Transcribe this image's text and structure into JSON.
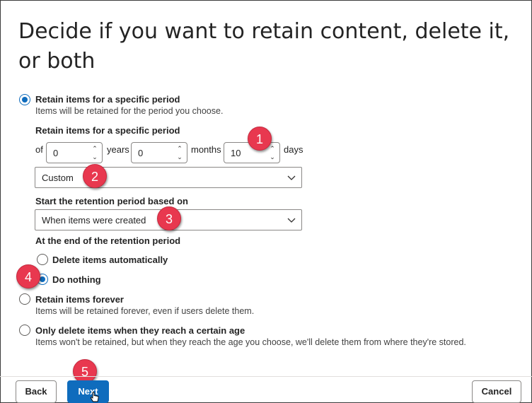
{
  "page": {
    "title": "Decide if you want to retain content, delete it, or both"
  },
  "options": {
    "retain_period": {
      "label": "Retain items for a specific period",
      "description": "Items will be retained for the period you choose.",
      "checked": true
    },
    "retain_forever": {
      "label": "Retain items forever",
      "description": "Items will be retained forever, even if users delete them.",
      "checked": false
    },
    "only_delete": {
      "label": "Only delete items when they reach a certain age",
      "description": "Items won't be retained, but when they reach the age you choose, we'll delete them from where they're stored.",
      "checked": false
    }
  },
  "period": {
    "heading": "Retain items for a specific period",
    "of_label": "of",
    "years_value": "0",
    "years_label": "years",
    "months_value": "0",
    "months_label": "months",
    "days_value": "10",
    "days_label": "days",
    "preset_value": "Custom"
  },
  "retention_start": {
    "heading": "Start the retention period based on",
    "value": "When items were created"
  },
  "end_of_period": {
    "heading": "At the end of the retention period",
    "delete_label": "Delete items automatically",
    "delete_checked": false,
    "nothing_label": "Do nothing",
    "nothing_checked": true
  },
  "callouts": [
    "1",
    "2",
    "3",
    "4",
    "5"
  ],
  "footer": {
    "back_label": "Back",
    "next_label": "Next",
    "cancel_label": "Cancel"
  },
  "colors": {
    "accent": "#0f6cbd",
    "callout": "#e8384f"
  }
}
